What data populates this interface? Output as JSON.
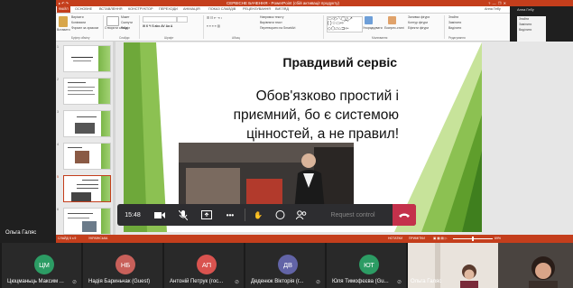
{
  "window": {
    "title": "СЕРВІСНЕ БАЧЕННЯ - PowerPoint (сбій активації продукту)",
    "quick_access": "▸ ↶ ↷",
    "user": "Анна Гебу",
    "share": "Загальний"
  },
  "ribbon_tabs": [
    "ФАЙЛ",
    "ОСНОВНЕ",
    "ВСТАВЛЕННЯ",
    "КОНСТРУКТОР",
    "ПЕРЕХОДИ",
    "АНІМАЦІЯ",
    "ПОКАЗ СЛАЙДІВ",
    "РЕЦЕНЗУВАННЯ",
    "ВИГЛЯД"
  ],
  "ribbon": {
    "paste": "Вставити",
    "cut": "Вирізати",
    "copy": "Копіювати",
    "format_painter": "Формат за зразком",
    "clipboard_group": "Буфер обміну",
    "new_slide": "Створити слайд",
    "layout": "Макет",
    "reset": "Скинути",
    "section": "Розділ",
    "slides_group": "Слайди",
    "font_group": "Шрифт",
    "paragraph_group": "Абзац",
    "text_direction": "Напрямок тексту",
    "align_text": "Вирівняти текст",
    "smartart": "Перетворити на SmartArt",
    "arrange": "Упорядкувати",
    "quick_styles": "Експрес-стилі",
    "shape_fill": "Заливка фігури",
    "shape_outline": "Контур фігури",
    "shape_effects": "Ефекти фігури",
    "drawing_group": "Малювання",
    "find": "Знайти",
    "replace": "Замінити",
    "select": "Виділити",
    "editing_group": "Редагування"
  },
  "slide": {
    "title": "Правдивий сервіс",
    "body": "Обов'язково простий і приємний, бо є системою цінностей, а не правил!"
  },
  "thumbnails": [
    {
      "num": "1"
    },
    {
      "num": "2"
    },
    {
      "num": "3"
    },
    {
      "num": "4"
    },
    {
      "num": "5"
    },
    {
      "num": "6"
    }
  ],
  "statusbar": {
    "slide_info": "СЛАЙД 5 з 9",
    "language": "УКРАЇНСЬКА",
    "notes": "НОТАТКИ",
    "comments": "ПРИМІТКИ",
    "zoom": "69%"
  },
  "meeting": {
    "presenter_name": "Ольга Галяс",
    "time": "15:48",
    "request_control": "Request control",
    "participants": [
      {
        "initials": "ЦМ",
        "name": "Цюцманьць Максим ...",
        "color": "#2c9c64"
      },
      {
        "initials": "НБ",
        "name": "Надія Бариньчак (Guest)",
        "color": "#c8605a"
      },
      {
        "initials": "АП",
        "name": "Антоній Петрук (гос...",
        "color": "#d9534f"
      },
      {
        "initials": "ДВ",
        "name": "Деденюк Вікторія (г...",
        "color": "#6264a7"
      },
      {
        "initials": "ЮТ",
        "name": "Юля Тимофєєва (Gu...",
        "color": "#2c9c64"
      }
    ],
    "video_name": "Ольга Галяс"
  },
  "colors": {
    "accent": "#c43e1c",
    "green": "#7ab648",
    "hangup": "#c4314b",
    "toolbar": "#2d2d30"
  }
}
